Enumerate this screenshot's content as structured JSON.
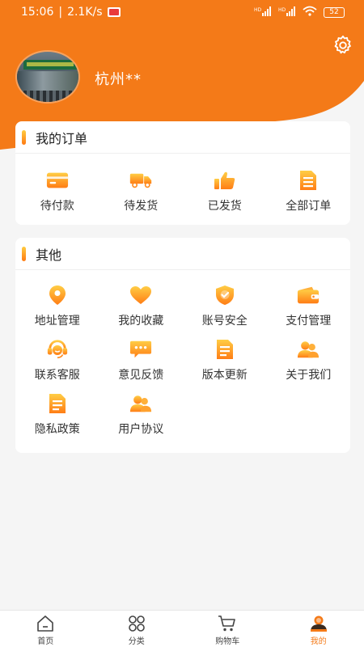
{
  "status_bar": {
    "time": "15:06",
    "speed": "2.1K/s",
    "battery": "52",
    "net1": "HD",
    "net2": "HD"
  },
  "user": {
    "name": "杭州**"
  },
  "orders": {
    "title": "我的订单",
    "items": [
      {
        "label": "待付款",
        "icon": "card-icon"
      },
      {
        "label": "待发货",
        "icon": "truck-icon"
      },
      {
        "label": "已发货",
        "icon": "thumbs-up-icon"
      },
      {
        "label": "全部订单",
        "icon": "list-doc-icon"
      }
    ]
  },
  "other": {
    "title": "其他",
    "items": [
      {
        "label": "地址管理",
        "icon": "location-pin-icon"
      },
      {
        "label": "我的收藏",
        "icon": "heart-icon"
      },
      {
        "label": "账号安全",
        "icon": "shield-check-icon"
      },
      {
        "label": "支付管理",
        "icon": "wallet-icon"
      },
      {
        "label": "联系客服",
        "icon": "headset-icon"
      },
      {
        "label": "意见反馈",
        "icon": "chat-bubble-icon"
      },
      {
        "label": "版本更新",
        "icon": "document-icon"
      },
      {
        "label": "关于我们",
        "icon": "users-icon"
      },
      {
        "label": "隐私政策",
        "icon": "document-icon"
      },
      {
        "label": "用户协议",
        "icon": "users-icon"
      }
    ]
  },
  "bottom_nav": [
    {
      "label": "首页",
      "icon": "home-icon"
    },
    {
      "label": "分类",
      "icon": "category-icon"
    },
    {
      "label": "购物车",
      "icon": "cart-icon"
    },
    {
      "label": "我的",
      "icon": "profile-icon",
      "active": true
    }
  ],
  "colors": {
    "accent": "#f47a18",
    "gradient_start": "#ffcc40",
    "gradient_end": "#ff7a12",
    "background": "#f5f5f5"
  }
}
